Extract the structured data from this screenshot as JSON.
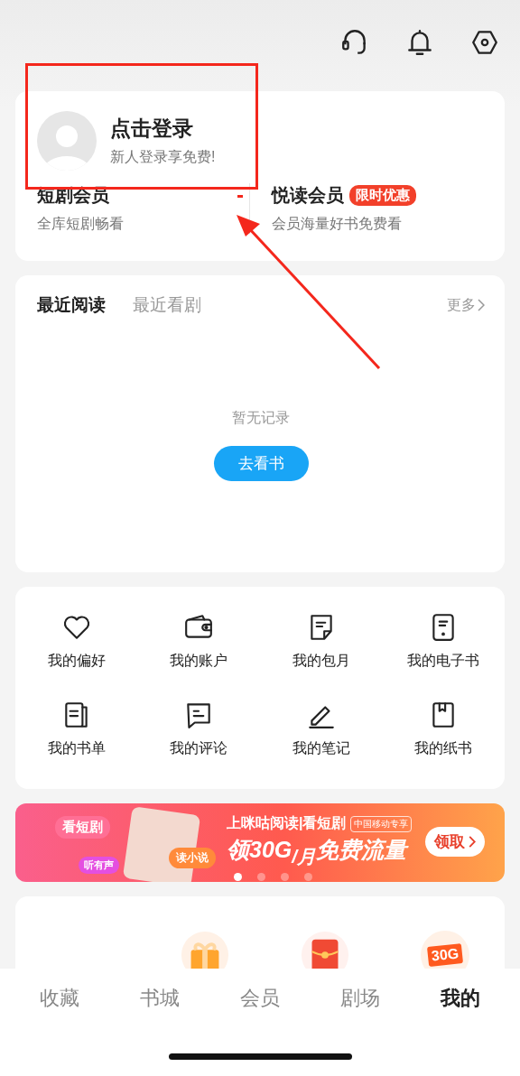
{
  "login": {
    "title": "点击登录",
    "subtitle": "新人登录享免费!"
  },
  "memberships": [
    {
      "title": "短剧会员",
      "subtitle": "全库短剧畅看"
    },
    {
      "title": "悦读会员",
      "badge": "限时优惠",
      "subtitle": "会员海量好书免费看"
    }
  ],
  "recent": {
    "tabs": [
      {
        "label": "最近阅读",
        "selected": true
      },
      {
        "label": "最近看剧",
        "selected": false
      }
    ],
    "more": "更多",
    "empty_text": "暂无记录",
    "action": "去看书"
  },
  "shortcuts": [
    {
      "kind": "heart",
      "label": "我的偏好"
    },
    {
      "kind": "wallet",
      "label": "我的账户"
    },
    {
      "kind": "note",
      "label": "我的包月"
    },
    {
      "kind": "tablet",
      "label": "我的电子书"
    },
    {
      "kind": "booklist",
      "label": "我的书单"
    },
    {
      "kind": "comment",
      "label": "我的评论"
    },
    {
      "kind": "pen",
      "label": "我的笔记"
    },
    {
      "kind": "book",
      "label": "我的纸书"
    }
  ],
  "banner": {
    "bubbles": [
      "看短剧",
      "听有声",
      "读小说"
    ],
    "headline": "上咪咕阅读|看短剧",
    "tag": "中国移动专享",
    "slogan": "领30G$_{/月}$免费流量",
    "button": "领取",
    "dots": [
      {
        "selected": true
      },
      {
        "selected": false
      },
      {
        "selected": false
      },
      {
        "selected": false
      }
    ]
  },
  "rewards": [
    {
      "kind": "gift"
    },
    {
      "kind": "red-packet"
    },
    {
      "kind": "data",
      "label": "30G"
    }
  ],
  "tab_bar": [
    {
      "label": "收藏",
      "selected": false
    },
    {
      "label": "书城",
      "selected": false
    },
    {
      "label": "会员",
      "selected": false
    },
    {
      "label": "剧场",
      "selected": false
    },
    {
      "label": "我的",
      "selected": true
    }
  ]
}
